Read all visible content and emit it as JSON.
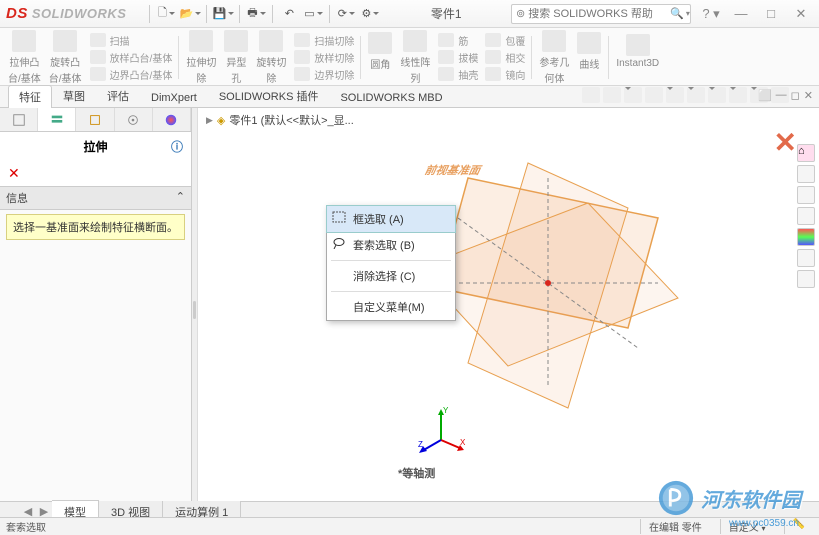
{
  "app": {
    "brand": "SOLIDWORKS",
    "doc_title": "零件1"
  },
  "search": {
    "placeholder": "搜索 SOLIDWORKS 帮助"
  },
  "ribbon": {
    "g1": {
      "l1": "拉伸凸",
      "l2": "台/基体"
    },
    "g2": {
      "l1": "旋转凸",
      "l2": "台/基体"
    },
    "g3a": "扫描",
    "g3b": "放样凸台/基体",
    "g3c": "边界凸台/基体",
    "g4": {
      "l1": "拉伸切",
      "l2": "除"
    },
    "g5": {
      "l1": "异型",
      "l2": "孔"
    },
    "g6": {
      "l1": "旋转切",
      "l2": "除"
    },
    "g7a": "扫描切除",
    "g7b": "放样切除",
    "g7c": "边界切除",
    "g8": "圆角",
    "g9": {
      "l1": "线性阵",
      "l2": "列"
    },
    "g10a": "筋",
    "g10b": "拔模",
    "g10c": "抽壳",
    "g11a": "包覆",
    "g11b": "相交",
    "g11c": "镜向",
    "g12": {
      "l1": "参考几",
      "l2": "何体"
    },
    "g13": "曲线",
    "g14": "Instant3D"
  },
  "tabs": {
    "t1": "特征",
    "t2": "草图",
    "t3": "评估",
    "t4": "DimXpert",
    "t5": "SOLIDWORKS 插件",
    "t6": "SOLIDWORKS MBD"
  },
  "panel": {
    "title": "拉伸",
    "section": "信息",
    "hint": "选择一基准面来绘制特征横断面。"
  },
  "breadcrumb": "零件1 (默认<<默认>_显...",
  "context": {
    "i1": "框选取 (A)",
    "i2": "套索选取 (B)",
    "i3": "消除选择 (C)",
    "i4": "自定义菜单(M)"
  },
  "viewport": {
    "plane_label": "前视基准面",
    "triad": "*等轴测"
  },
  "bottom_tabs": {
    "b1": "模型",
    "b2": "3D 视图",
    "b3": "运动算例 1"
  },
  "status": {
    "left": "套索选取",
    "r1": "在编辑 零件",
    "r2": "自定义"
  },
  "watermark": {
    "text": "河东软件园",
    "url": "www.pc0359.cn"
  }
}
